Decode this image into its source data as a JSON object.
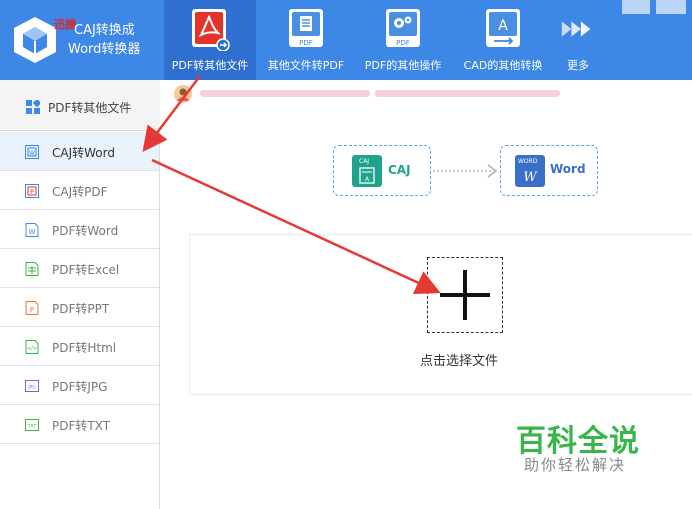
{
  "logo": {
    "badge": "迅捷",
    "line1": "CAJ转换成",
    "line2": "Word转换器"
  },
  "toolbar": [
    {
      "label": "PDF转其他文件",
      "icon": "pdf-acrobat-icon",
      "active": true
    },
    {
      "label": "其他文件转PDF",
      "icon": "doc-to-pdf-icon",
      "active": false
    },
    {
      "label": "PDF的其他操作",
      "icon": "pdf-gear-icon",
      "active": false
    },
    {
      "label": "CAD的其他转换",
      "icon": "cad-convert-icon",
      "active": false
    },
    {
      "label": "更多",
      "icon": "more-arrows-icon",
      "active": false
    }
  ],
  "sidebar": {
    "header": "PDF转其他文件",
    "items": [
      {
        "label": "CAJ转Word",
        "icon": "caj-word-icon",
        "active": true
      },
      {
        "label": "CAJ转PDF",
        "icon": "caj-pdf-icon",
        "active": false
      },
      {
        "label": "PDF转Word",
        "icon": "word-file-icon",
        "active": false
      },
      {
        "label": "PDF转Excel",
        "icon": "excel-file-icon",
        "active": false
      },
      {
        "label": "PDF转PPT",
        "icon": "ppt-file-icon",
        "active": false
      },
      {
        "label": "PDF转Html",
        "icon": "html-file-icon",
        "active": false
      },
      {
        "label": "PDF转JPG",
        "icon": "jpg-file-icon",
        "active": false
      },
      {
        "label": "PDF转TXT",
        "icon": "txt-file-icon",
        "active": false
      }
    ]
  },
  "conversion": {
    "from": {
      "label": "CAJ",
      "icon_text": "CAJ",
      "color": "#1fa38c"
    },
    "to": {
      "label": "Word",
      "icon_text": "WORD",
      "color": "#3a6fc8"
    }
  },
  "upload": {
    "label": "点击选择文件"
  },
  "watermark": {
    "title": "百科全说",
    "subtitle": "助你轻松解决"
  },
  "colors": {
    "header": "#3d87e6",
    "active_tool": "#2e6fd0",
    "annotation_arrow": "#e53935",
    "watermark_green": "#3ab54a"
  }
}
